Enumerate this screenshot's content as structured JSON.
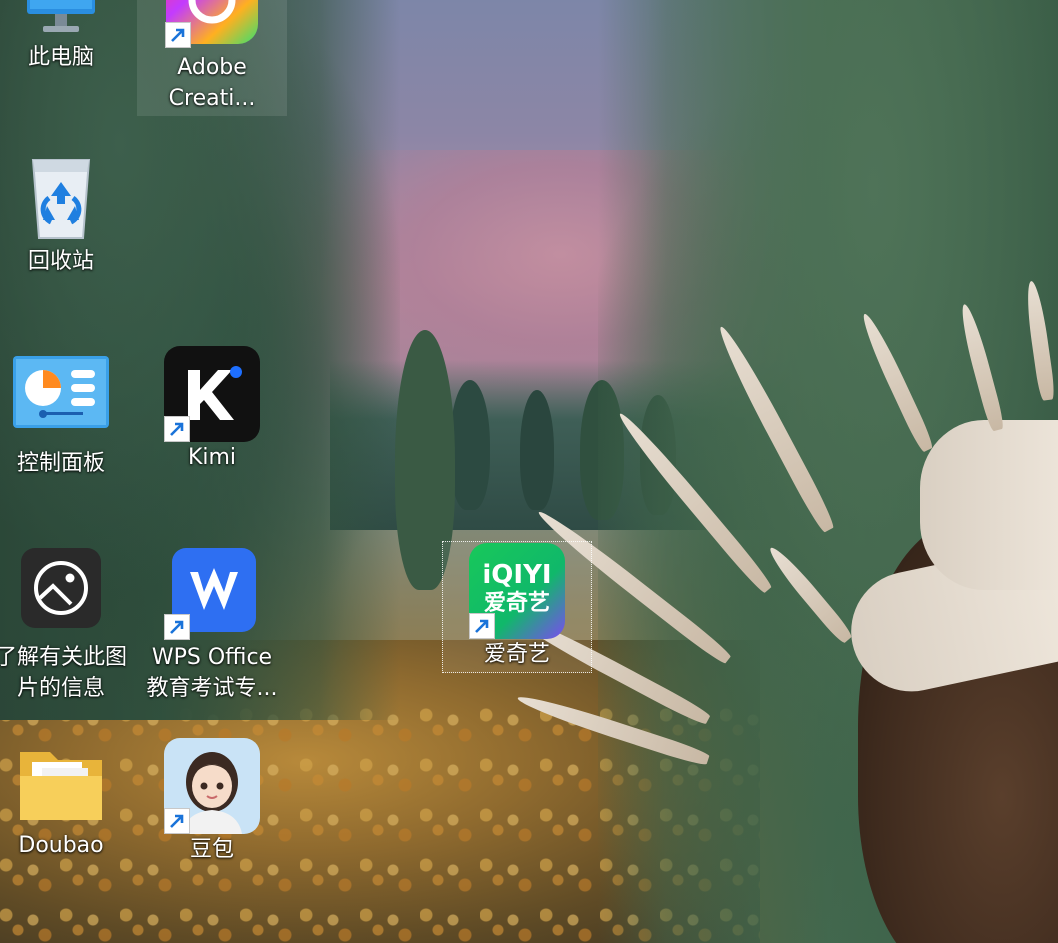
{
  "desktop": {
    "icons": [
      {
        "label": "此电脑"
      },
      {
        "label_line1": "Adobe",
        "label_line2": "Creati..."
      },
      {
        "label": "回收站"
      },
      {
        "label": "控制面板"
      },
      {
        "label": "Kimi"
      },
      {
        "label_line1": "了解有关此图",
        "label_line2": "片的信息"
      },
      {
        "label_line1": "WPS Office",
        "label_line2": "教育考试专..."
      },
      {
        "label": "爱奇艺",
        "logo_line1": "iQIYI",
        "logo_line2": "爱奇艺"
      },
      {
        "label": "Doubao"
      },
      {
        "label": "豆包"
      }
    ]
  },
  "colors": {
    "kimi_bg": "#111111",
    "kimi_dot": "#1e6fff",
    "wps_bg": "#2e6ff2",
    "iqiyi_green": "#19c35a",
    "shortcut_arrow": "#1a73d9"
  }
}
